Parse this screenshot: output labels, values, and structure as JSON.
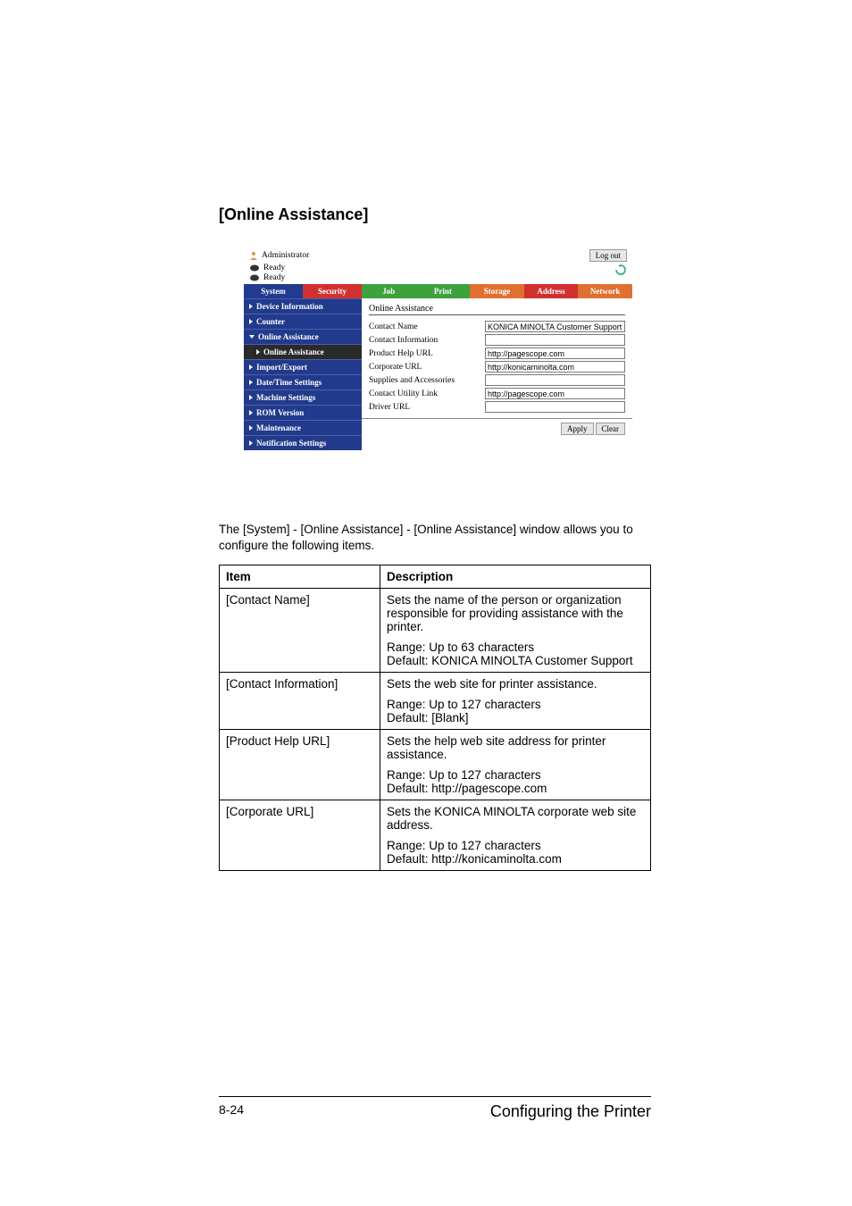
{
  "heading": "[Online Assistance]",
  "shot": {
    "admin_label": "Administrator",
    "logout_label": "Log out",
    "status1": "Ready",
    "status2": "Ready",
    "tabs": {
      "system": "System",
      "security": "Security",
      "job": "Job",
      "print": "Print",
      "storage": "Storage",
      "address": "Address",
      "network": "Network"
    },
    "sidebar": [
      {
        "label": "Device Information",
        "expanded": false
      },
      {
        "label": "Counter",
        "expanded": false
      },
      {
        "label": "Online Assistance",
        "expanded": true
      },
      {
        "label": "Online Assistance",
        "sub": true
      },
      {
        "label": "Import/Export",
        "expanded": false
      },
      {
        "label": "Date/Time Settings",
        "expanded": false
      },
      {
        "label": "Machine Settings",
        "expanded": false
      },
      {
        "label": "ROM Version",
        "expanded": false
      },
      {
        "label": "Maintenance",
        "expanded": false
      },
      {
        "label": "Notification Settings",
        "expanded": false
      }
    ],
    "main": {
      "title": "Online Assistance",
      "fields": [
        {
          "label": "Contact Name",
          "value": "KONICA MINOLTA Customer Support"
        },
        {
          "label": "Contact Information",
          "value": ""
        },
        {
          "label": "Product Help URL",
          "value": "http://pagescope.com"
        },
        {
          "label": "Corporate URL",
          "value": "http://konicaminolta.com"
        },
        {
          "label": "Supplies and Accessories",
          "value": ""
        },
        {
          "label": "Contact Utility Link",
          "value": "http://pagescope.com"
        },
        {
          "label": "Driver URL",
          "value": ""
        }
      ],
      "apply_label": "Apply",
      "clear_label": "Clear"
    }
  },
  "intro_text": "The [System] - [Online Assistance] - [Online Assistance] window allows you to configure the following items.",
  "table": {
    "headers": [
      "Item",
      "Description"
    ],
    "rows": [
      {
        "item": "[Contact Name]",
        "desc1": "Sets the name of the person or organization responsible for providing assistance with the printer.",
        "desc2": "Range:   Up to 63 characters\nDefault:  KONICA MINOLTA Customer Support"
      },
      {
        "item": "[Contact Information]",
        "desc1": "Sets the web site for printer assistance.",
        "desc2": "Range:   Up to 127 characters\nDefault:  [Blank]"
      },
      {
        "item": "[Product Help URL]",
        "desc1": "Sets the help web site address for printer assistance.",
        "desc2": "Range:   Up to 127 characters\nDefault:  http://pagescope.com"
      },
      {
        "item": "[Corporate URL]",
        "desc1": "Sets the KONICA MINOLTA corporate web site address.",
        "desc2": "Range:   Up to 127 characters\nDefault:  http://konicaminolta.com"
      }
    ]
  },
  "footer": {
    "left": "8-24",
    "right": "Configuring the Printer"
  }
}
